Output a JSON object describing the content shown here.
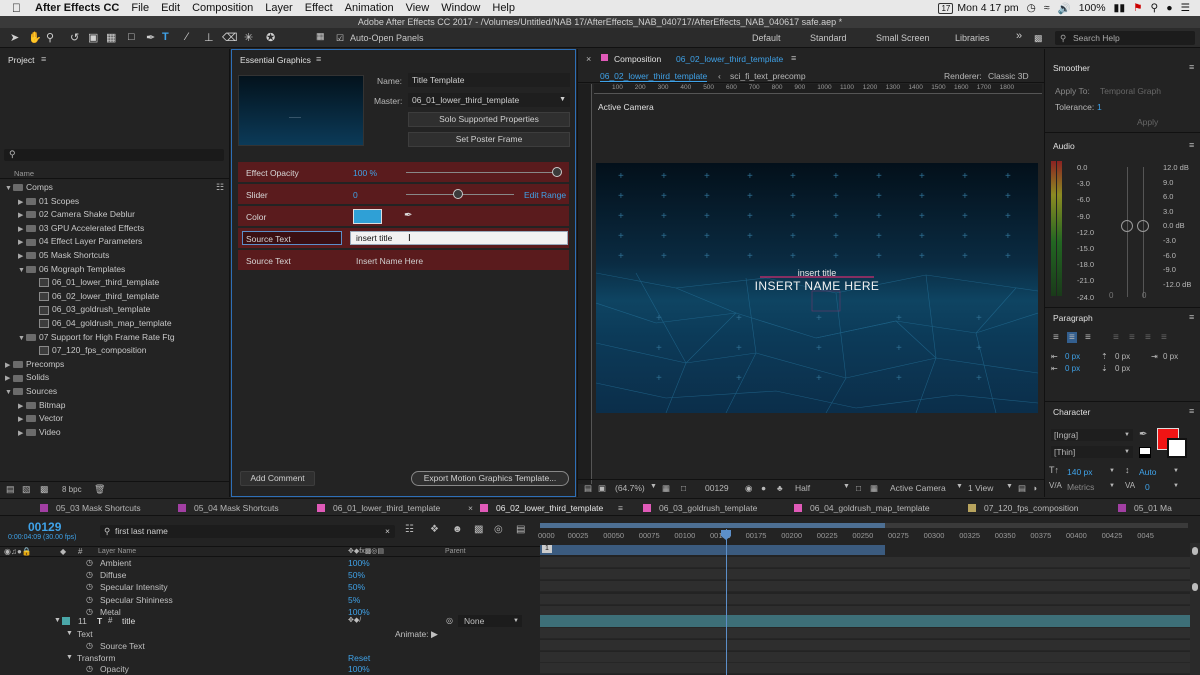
{
  "menubar": {
    "apple": "",
    "app": "After Effects CC",
    "items": [
      "File",
      "Edit",
      "Composition",
      "Layer",
      "Effect",
      "Animation",
      "View",
      "Window",
      "Help"
    ],
    "time": "Mon 4 17 pm",
    "battery": "100%",
    "cal": "17"
  },
  "titlebar": "Adobe After Effects CC 2017 - /Volumes/Untitled/NAB 17/AfterEffects_NAB_040717/AfterEffects_NAB_040617 safe.aep *",
  "toolbar": {
    "auto_open": "Auto-Open Panels",
    "workspaces": [
      "Default",
      "Standard",
      "Small Screen",
      "Libraries"
    ],
    "search": "Search Help",
    "more": "»"
  },
  "project": {
    "title": "Project",
    "col_name": "Name",
    "bpc": "8 bpc",
    "tree": [
      {
        "label": "Comps",
        "depth": 0,
        "kind": "folder",
        "open": true
      },
      {
        "label": "01 Scopes",
        "depth": 1,
        "kind": "folder",
        "open": false
      },
      {
        "label": "02 Camera Shake Deblur",
        "depth": 1,
        "kind": "folder",
        "open": false
      },
      {
        "label": "03 GPU Accelerated Effects",
        "depth": 1,
        "kind": "folder",
        "open": false
      },
      {
        "label": "04 Effect Layer Parameters",
        "depth": 1,
        "kind": "folder",
        "open": false
      },
      {
        "label": "05 Mask Shortcuts",
        "depth": 1,
        "kind": "folder",
        "open": false
      },
      {
        "label": "06 Mograph Templates",
        "depth": 1,
        "kind": "folder",
        "open": true
      },
      {
        "label": "06_01_lower_third_template",
        "depth": 2,
        "kind": "comp"
      },
      {
        "label": "06_02_lower_third_template",
        "depth": 2,
        "kind": "comp"
      },
      {
        "label": "06_03_goldrush_template",
        "depth": 2,
        "kind": "comp"
      },
      {
        "label": "06_04_goldrush_map_template",
        "depth": 2,
        "kind": "comp"
      },
      {
        "label": "07 Support for High Frame Rate Ftg",
        "depth": 1,
        "kind": "folder",
        "open": true
      },
      {
        "label": "07_120_fps_composition",
        "depth": 2,
        "kind": "comp"
      },
      {
        "label": "Precomps",
        "depth": 0,
        "kind": "folder",
        "open": false
      },
      {
        "label": "Solids",
        "depth": 0,
        "kind": "folder",
        "open": false
      },
      {
        "label": "Sources",
        "depth": 0,
        "kind": "folder",
        "open": true
      },
      {
        "label": "Bitmap",
        "depth": 1,
        "kind": "folder",
        "open": false
      },
      {
        "label": "Vector",
        "depth": 1,
        "kind": "folder",
        "open": false
      },
      {
        "label": "Video",
        "depth": 1,
        "kind": "folder",
        "open": false
      }
    ]
  },
  "eg": {
    "title": "Essential Graphics",
    "name_label": "Name:",
    "name_value": "Title Template",
    "master_label": "Master:",
    "master_value": "06_01_lower_third_template",
    "solo_btn": "Solo Supported Properties",
    "poster_btn": "Set Poster Frame",
    "opacity_label": "Effect Opacity",
    "opacity_value": "100 %",
    "slider_label": "Slider",
    "slider_value": "0",
    "edit_range": "Edit Range",
    "color_label": "Color",
    "color_value": "#2fa0d6",
    "src1_label": "Source Text",
    "src1_value": "insert title",
    "src2_label": "Source Text",
    "src2_value": "Insert Name Here",
    "add_comment": "Add Comment",
    "export_btn": "Export Motion Graphics Template..."
  },
  "comp": {
    "panel_prefix": "Composition",
    "panel_name": "06_02_lower_third_template",
    "breadcrumb1": "06_02_lower_third_template",
    "breadcrumb2": "sci_fi_text_precomp",
    "renderer_label": "Renderer:",
    "renderer_value": "Classic 3D",
    "active_camera": "Active Camera",
    "ruler": [
      "100",
      "200",
      "300",
      "400",
      "500",
      "600",
      "700",
      "800",
      "900",
      "1000",
      "1100",
      "1200",
      "1300",
      "1400",
      "1500",
      "1600",
      "1700",
      "1800"
    ],
    "title_text": "insert title",
    "name_text": "INSERT NAME HERE",
    "zoom": "(64.7%)",
    "frame": "00129",
    "resolution": "Half",
    "view_camera": "Active Camera",
    "views": "1 View"
  },
  "right": {
    "smoother": "Smoother",
    "apply_to_label": "Apply To:",
    "apply_to_value": "Temporal Graph",
    "tolerance_label": "Tolerance:",
    "tolerance_value": "1",
    "apply_btn": "Apply",
    "audio": "Audio",
    "audio_left": [
      "0.0",
      "-3.0",
      "-6.0",
      "-9.0",
      "-12.0",
      "-15.0",
      "-18.0",
      "-21.0",
      "-24.0"
    ],
    "audio_right": [
      "12.0 dB",
      "9.0",
      "6.0",
      "3.0",
      "0.0 dB",
      "-3.0",
      "-6.0",
      "-9.0",
      "-12.0 dB"
    ],
    "zero1": "0",
    "zero2": "0",
    "paragraph": "Paragraph",
    "px": [
      "0 px",
      "0 px",
      "0 px",
      "0 px",
      "0 px"
    ],
    "character": "Character",
    "font": "[Ingra]",
    "style": "[Thin]",
    "size": "140 px",
    "leading": "Auto",
    "metrics": "Metrics",
    "tracking": "0"
  },
  "tabs": [
    "05_03 Mask Shortcuts",
    "05_04 Mask Shortcuts",
    "06_01_lower_third_template",
    "06_02_lower_third_template",
    "06_03_goldrush_template",
    "06_04_goldrush_map_template",
    "07_120_fps_composition",
    "05_01 Ma"
  ],
  "tab_colors": [
    "#a23fa3",
    "#a23fa3",
    "#e05ab8",
    "#e05ab8",
    "#e05ab8",
    "#e05ab8",
    "#b8a45e",
    "#a23fa3"
  ],
  "timeline": {
    "timecode": "00129",
    "timecode_sub": "0:00:04:09 (30.00 fps)",
    "search": "first last name",
    "col_layer": "Layer Name",
    "col_parent": "Parent",
    "ruler": [
      "0000",
      "00025",
      "00050",
      "00075",
      "00100",
      "00150",
      "00175",
      "00200",
      "00225",
      "00250",
      "00275",
      "00300",
      "00325",
      "00350",
      "00375",
      "00400",
      "00425",
      "0045"
    ],
    "rows": [
      {
        "name": "Ambient",
        "value": "100%"
      },
      {
        "name": "Diffuse",
        "value": "50%"
      },
      {
        "name": "Specular Intensity",
        "value": "50%"
      },
      {
        "name": "Specular Shininess",
        "value": "5%"
      },
      {
        "name": "Metal",
        "value": "100%"
      }
    ],
    "layer_num": "11",
    "layer_name": "title",
    "parent_value": "None",
    "text_group": "Text",
    "animate": "Animate:",
    "source_text": "Source Text",
    "transform": "Transform",
    "reset": "Reset",
    "opacity": "Opacity",
    "opacity_value": "100%"
  }
}
